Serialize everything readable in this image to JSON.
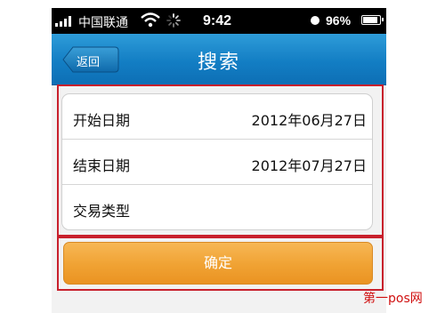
{
  "status_bar": {
    "carrier": "中国联通",
    "time": "9:42",
    "battery_percent": "96%",
    "battery_level": 0.96,
    "icons": [
      "signal-icon",
      "wifi-icon",
      "activity-spinner-icon",
      "alarm-icon",
      "battery-icon"
    ]
  },
  "nav": {
    "back_label": "返回",
    "title": "搜索"
  },
  "form": {
    "rows": [
      {
        "label": "开始日期",
        "value": "2012年06月27日"
      },
      {
        "label": "结束日期",
        "value": "2012年07月27日"
      },
      {
        "label": "交易类型",
        "value": ""
      }
    ]
  },
  "confirm_label": "确定",
  "watermark": "第一pos网",
  "colors": {
    "nav_bar": "#137ec4",
    "confirm_button": "#f0a233",
    "highlight_frame": "#c8202c",
    "watermark": "#d01010"
  }
}
